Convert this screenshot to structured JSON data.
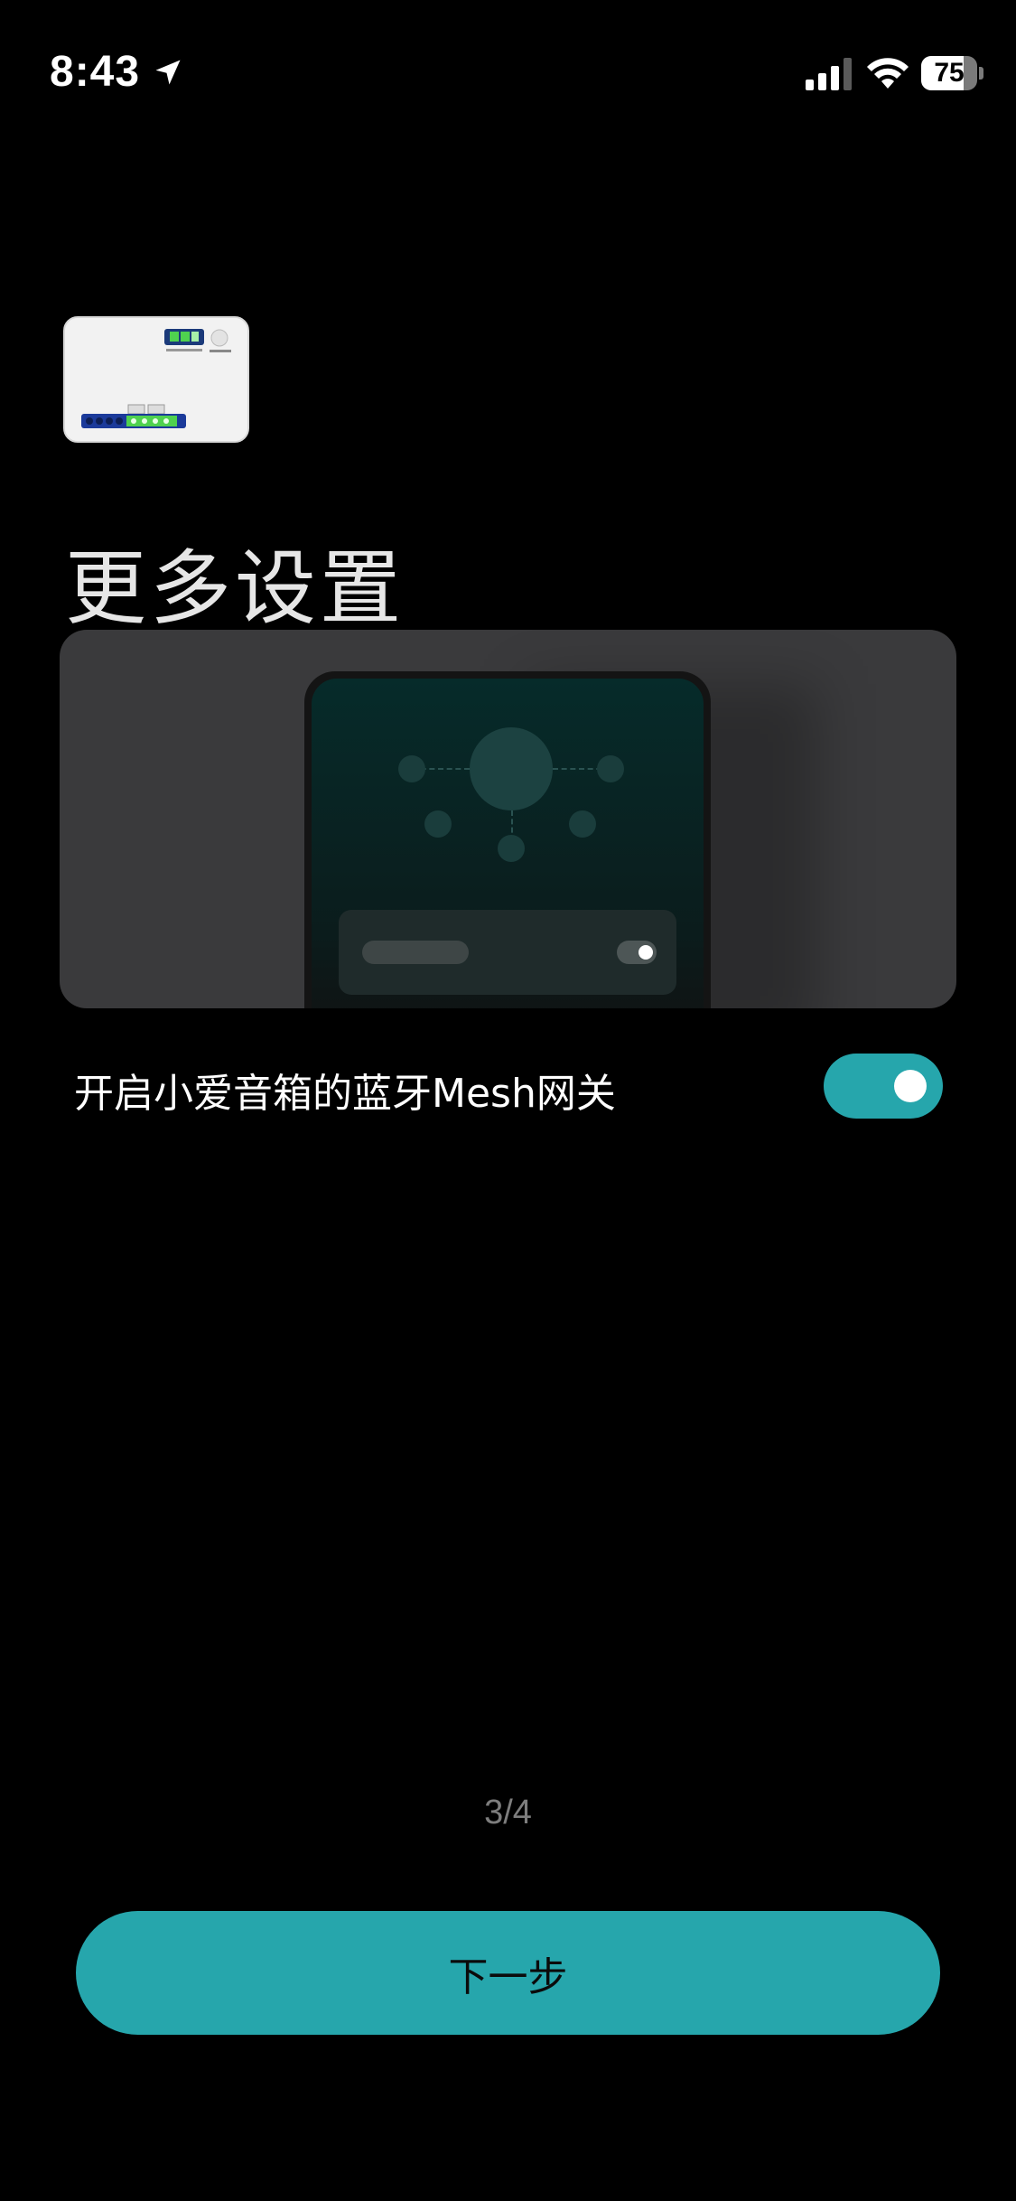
{
  "status_bar": {
    "time": "8:43",
    "battery_level": "75",
    "battery_fraction": 0.75,
    "icons": [
      "location-arrow-icon",
      "cellular-signal-icon",
      "wifi-icon",
      "battery-icon"
    ]
  },
  "header": {
    "title": "更多设置"
  },
  "setting": {
    "label": "开启小爱音箱的蓝牙Mesh网关",
    "enabled": true
  },
  "pagination": {
    "text": "3/4"
  },
  "footer": {
    "next_label": "下一步"
  },
  "colors": {
    "accent": "#26a6ac",
    "background": "#000000",
    "card": "#3a3a3c"
  }
}
